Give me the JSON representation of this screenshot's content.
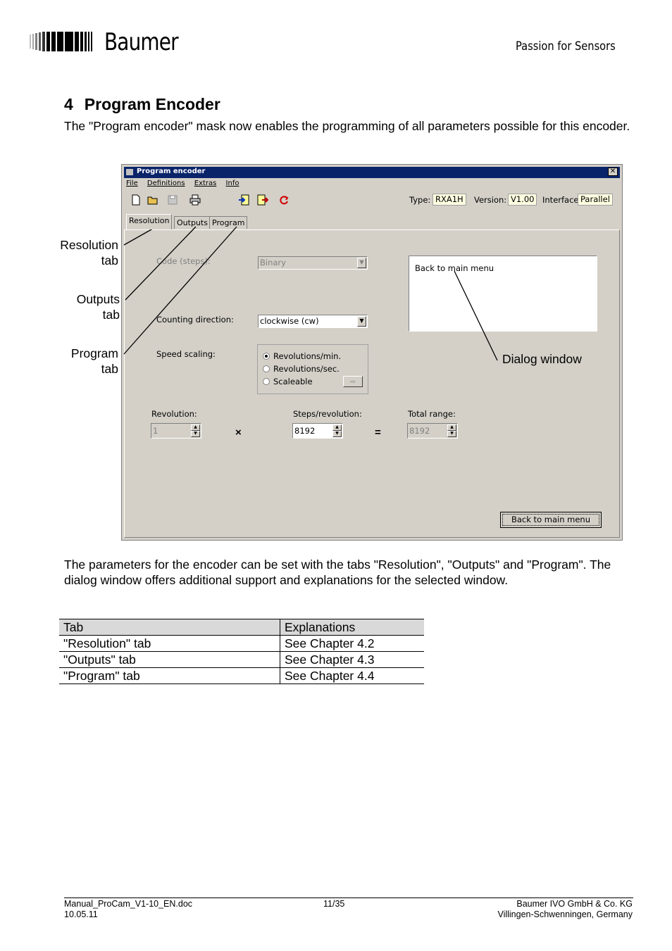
{
  "header": {
    "brand": "Baumer",
    "tagline": "Passion for Sensors"
  },
  "section": {
    "number": "4",
    "title": "Program Encoder",
    "intro": "The \"Program encoder\" mask now enables the programming of all parameters possible for this encoder."
  },
  "screenshot": {
    "window_title": "Program encoder",
    "close_glyph": "✕",
    "menu": [
      "File",
      "Definitions",
      "Extras",
      "Info"
    ],
    "type_label": "Type:",
    "type_value": "RXA1H",
    "version_label": "Version:",
    "version_value": "V1.00",
    "interface_label": "Interface:",
    "interface_value": "Parallel",
    "tabs": [
      "Resolution",
      "Outputs",
      "Program"
    ],
    "code_label": "Code (steps):",
    "code_value": "Binary",
    "counting_label": "Counting direction:",
    "counting_value": "clockwise (cw)",
    "speed_label": "Speed scaling:",
    "speed_options": [
      "Revolutions/min.",
      "Revolutions/sec.",
      "Scaleable"
    ],
    "speed_selected": "Revolutions/min.",
    "arrow_button": "⇨",
    "revolution_label": "Revolution:",
    "revolution_value": "1",
    "times": "×",
    "steps_label": "Steps/revolution:",
    "steps_value": "8192",
    "equals": "=",
    "total_label": "Total range:",
    "total_value": "8192",
    "dialog_text": "Back to main menu",
    "back_button": "Back to main menu"
  },
  "callouts": {
    "resolution": [
      "Resolution",
      "tab"
    ],
    "outputs": [
      "Outputs",
      "tab"
    ],
    "program": [
      "Program",
      "tab"
    ],
    "dialog": "Dialog window"
  },
  "body_text": "The parameters for the encoder can be set with the tabs  \"Resolution\", \"Outputs\" and \"Program\". The dialog window offers additional support and explanations for the selected window.",
  "table": {
    "headers": [
      "Tab",
      "Explanations"
    ],
    "rows": [
      [
        "\"Resolution\" tab",
        "See Chapter 4.2"
      ],
      [
        "\"Outputs\" tab",
        "See Chapter 4.3"
      ],
      [
        "\"Program\" tab",
        "See Chapter 4.4"
      ]
    ]
  },
  "footer": {
    "file": "Manual_ProCam_V1-10_EN.doc",
    "date": "10.05.11",
    "page": "11/35",
    "company": "Baumer IVO GmbH & Co. KG",
    "location": "Villingen-Schwenningen, Germany"
  }
}
